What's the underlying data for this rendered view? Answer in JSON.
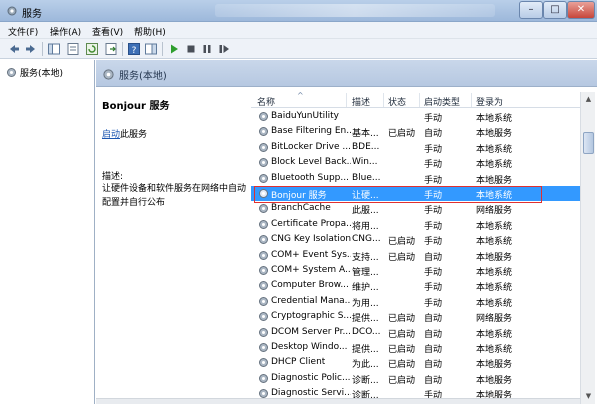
{
  "window": {
    "title": "服务"
  },
  "menu": [
    "文件(F)",
    "操作(A)",
    "查看(V)",
    "帮助(H)"
  ],
  "tree": {
    "root_label": "服务(本地)"
  },
  "band": {
    "title": "服务(本地)"
  },
  "description": {
    "service_title": "Bonjour 服务",
    "start_link": "启动",
    "start_suffix": "此服务",
    "desc_label": "描述:",
    "desc_text": "让硬件设备和软件服务在网络中自动配置并自行公布"
  },
  "columns": {
    "name": "名称",
    "desc": "描述",
    "status": "状态",
    "startup": "启动类型",
    "logon": "登录为"
  },
  "services": [
    {
      "name": "BaiduYunUtility",
      "desc": "",
      "status": "",
      "startup": "手动",
      "logon": "本地系统"
    },
    {
      "name": "Base Filtering En...",
      "desc": "基本...",
      "status": "已启动",
      "startup": "自动",
      "logon": "本地服务"
    },
    {
      "name": "BitLocker Drive ...",
      "desc": "BDE...",
      "status": "",
      "startup": "手动",
      "logon": "本地系统"
    },
    {
      "name": "Block Level Back...",
      "desc": "Win...",
      "status": "",
      "startup": "手动",
      "logon": "本地系统"
    },
    {
      "name": "Bluetooth Supp...",
      "desc": "Blue...",
      "status": "",
      "startup": "手动",
      "logon": "本地服务"
    },
    {
      "name": "Bonjour 服务",
      "desc": "让硬...",
      "status": "",
      "startup": "手动",
      "logon": "本地系统",
      "selected": true
    },
    {
      "name": "BranchCache",
      "desc": "此服...",
      "status": "",
      "startup": "手动",
      "logon": "网络服务"
    },
    {
      "name": "Certificate Propa...",
      "desc": "将用...",
      "status": "",
      "startup": "手动",
      "logon": "本地系统"
    },
    {
      "name": "CNG Key Isolation",
      "desc": "CNG...",
      "status": "已启动",
      "startup": "手动",
      "logon": "本地系统"
    },
    {
      "name": "COM+ Event Sys...",
      "desc": "支持...",
      "status": "已启动",
      "startup": "自动",
      "logon": "本地服务"
    },
    {
      "name": "COM+ System A...",
      "desc": "管理...",
      "status": "",
      "startup": "手动",
      "logon": "本地系统"
    },
    {
      "name": "Computer Brow...",
      "desc": "维护...",
      "status": "",
      "startup": "手动",
      "logon": "本地系统"
    },
    {
      "name": "Credential Mana...",
      "desc": "为用...",
      "status": "",
      "startup": "手动",
      "logon": "本地系统"
    },
    {
      "name": "Cryptographic S...",
      "desc": "提供...",
      "status": "已启动",
      "startup": "自动",
      "logon": "网络服务"
    },
    {
      "name": "DCOM Server Pr...",
      "desc": "DCO...",
      "status": "已启动",
      "startup": "自动",
      "logon": "本地系统"
    },
    {
      "name": "Desktop Windo...",
      "desc": "提供...",
      "status": "已启动",
      "startup": "自动",
      "logon": "本地系统"
    },
    {
      "name": "DHCP Client",
      "desc": "为此...",
      "status": "已启动",
      "startup": "自动",
      "logon": "本地服务"
    },
    {
      "name": "Diagnostic Polic...",
      "desc": "诊断...",
      "status": "已启动",
      "startup": "自动",
      "logon": "本地服务"
    },
    {
      "name": "Diagnostic Servi...",
      "desc": "诊断...",
      "status": "",
      "startup": "手动",
      "logon": "本地服务"
    }
  ],
  "colors": {
    "selection": "#3399ff",
    "highlight_box": "#e03030",
    "link": "#1a55b0"
  }
}
